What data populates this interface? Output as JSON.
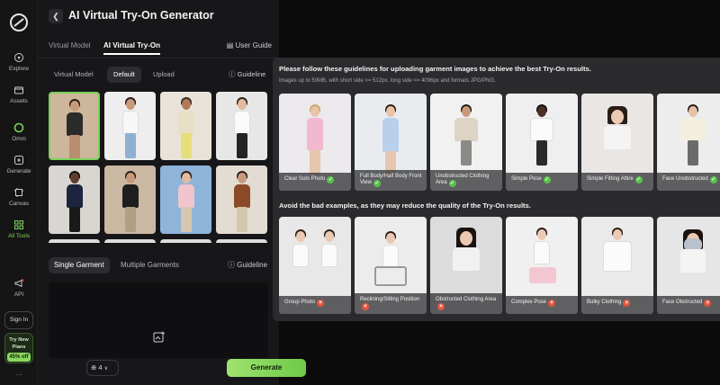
{
  "rail": {
    "items": [
      {
        "label": "Explore",
        "icon": "compass-icon"
      },
      {
        "label": "Assets",
        "icon": "folder-icon"
      },
      {
        "label": "Omni",
        "icon": "omni-icon"
      },
      {
        "label": "Generate",
        "icon": "generate-icon"
      },
      {
        "label": "Canvas",
        "icon": "canvas-icon"
      },
      {
        "label": "All Tools",
        "icon": "grid-icon"
      },
      {
        "label": "API",
        "icon": "megaphone-icon"
      }
    ],
    "signin": "Sign In",
    "plans_label": "Try New Plans",
    "plans_discount": "45% off",
    "more": "..."
  },
  "panel": {
    "title": "AI Virtual Try-On Generator",
    "tabs": [
      "Virtual Model",
      "AI Virtual Try-On"
    ],
    "user_guide": "User Guide",
    "model_tabs": [
      "Virtual Model",
      "Default",
      "Upload"
    ],
    "guideline": "Guideline",
    "garment_tabs": [
      "Single Garment",
      "Multiple Garments"
    ],
    "count": "4",
    "generate": "Generate"
  },
  "colors": {
    "accent": "#7ed25b",
    "panel_bg": "#17171a",
    "popover_bg": "#2b2b2e"
  },
  "popover": {
    "heading": "Please follow these guidelines for uploading garment images to achieve the best Try-On results.",
    "requirements": "Images up to 50MB, with short side >= 512px, long side <= 4096px and formats JPG/PNG.",
    "good": [
      {
        "caption": "Clear Solo Photo"
      },
      {
        "caption": "Full Body/Half Body Front View"
      },
      {
        "caption": "Unobstructed Clothing Area"
      },
      {
        "caption": "Simple Pose"
      },
      {
        "caption": "Simple Fitting Attire"
      },
      {
        "caption": "Face Unobstructed"
      }
    ],
    "bad_heading": "Avoid the bad examples, as they may reduce the quality of the Try-On results.",
    "bad": [
      {
        "caption": "Group Photo"
      },
      {
        "caption": "Reclining/Sitting Position"
      },
      {
        "caption": "Obstructed Clothing Area"
      },
      {
        "caption": "Complex Pose"
      },
      {
        "caption": "Bulky Clothing"
      },
      {
        "caption": "Face Obstructed"
      }
    ]
  }
}
